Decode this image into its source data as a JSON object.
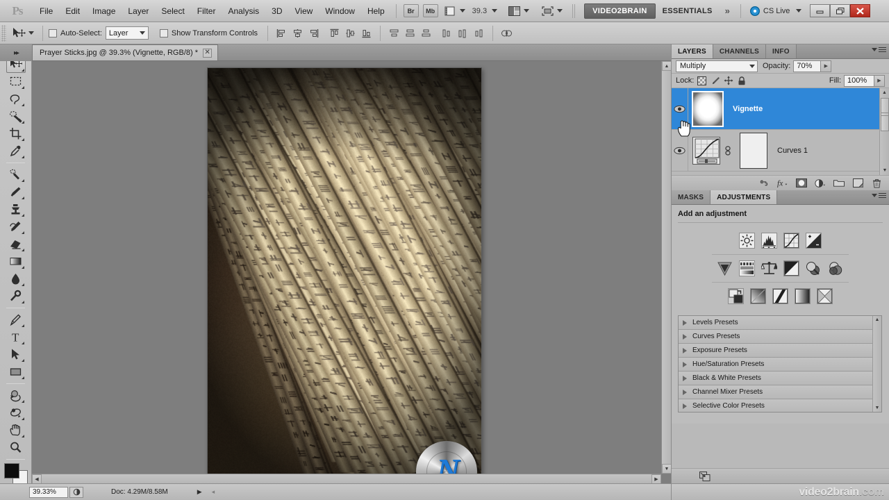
{
  "app": {
    "name": "Adobe Photoshop CS5",
    "logo_text": "Ps"
  },
  "menubar": {
    "items": [
      "File",
      "Edit",
      "Image",
      "Layer",
      "Select",
      "Filter",
      "Analysis",
      "3D",
      "View",
      "Window",
      "Help"
    ],
    "bridge_label": "Br",
    "minibridge_label": "Mb",
    "zoom_value": "39.3",
    "workspace_active": "VIDEO2BRAIN",
    "workspace_secondary": "ESSENTIALS",
    "overflow_label": "»",
    "cs_live_label": "CS Live",
    "window_buttons": {
      "minimize": "–",
      "restore": "❐",
      "close": "✕"
    }
  },
  "optionsbar": {
    "tool_icon": "move-tool-icon",
    "auto_select_label": "Auto-Select:",
    "auto_select_checked": false,
    "auto_select_value": "Layer",
    "show_transform_label": "Show Transform Controls",
    "show_transform_checked": false,
    "align_icons": [
      "align-left-edges-icon",
      "align-horizontal-centers-icon",
      "align-right-edges-icon",
      "align-top-edges-icon",
      "align-vertical-centers-icon",
      "align-bottom-edges-icon"
    ],
    "distribute_icons": [
      "distribute-top-edges-icon",
      "distribute-vertical-centers-icon",
      "distribute-bottom-edges-icon",
      "distribute-left-edges-icon",
      "distribute-horizontal-centers-icon",
      "distribute-right-edges-icon"
    ],
    "threed_axis_icon": "3d-axis-icon"
  },
  "toolbar": {
    "tools": [
      {
        "name": "move-tool",
        "selected": true,
        "has_submenu": true
      },
      {
        "name": "rectangular-marquee-tool",
        "selected": false,
        "has_submenu": true
      },
      {
        "name": "lasso-tool",
        "selected": false,
        "has_submenu": true
      },
      {
        "name": "quick-selection-tool",
        "selected": false,
        "has_submenu": true
      },
      {
        "name": "crop-tool",
        "selected": false,
        "has_submenu": true
      },
      {
        "name": "eyedropper-tool",
        "selected": false,
        "has_submenu": true
      },
      {
        "name": "spot-healing-brush-tool",
        "selected": false,
        "has_submenu": true
      },
      {
        "name": "brush-tool",
        "selected": false,
        "has_submenu": true
      },
      {
        "name": "clone-stamp-tool",
        "selected": false,
        "has_submenu": true
      },
      {
        "name": "history-brush-tool",
        "selected": false,
        "has_submenu": true
      },
      {
        "name": "eraser-tool",
        "selected": false,
        "has_submenu": true
      },
      {
        "name": "gradient-tool",
        "selected": false,
        "has_submenu": true
      },
      {
        "name": "blur-tool",
        "selected": false,
        "has_submenu": true
      },
      {
        "name": "dodge-tool",
        "selected": false,
        "has_submenu": true
      },
      {
        "name": "pen-tool",
        "selected": false,
        "has_submenu": true
      },
      {
        "name": "horizontal-type-tool",
        "selected": false,
        "has_submenu": true
      },
      {
        "name": "path-selection-tool",
        "selected": false,
        "has_submenu": true
      },
      {
        "name": "rectangle-shape-tool",
        "selected": false,
        "has_submenu": true
      },
      {
        "name": "3d-object-rotate-tool",
        "selected": false,
        "has_submenu": true
      },
      {
        "name": "3d-camera-orbit-tool",
        "selected": false,
        "has_submenu": true
      },
      {
        "name": "hand-tool",
        "selected": false,
        "has_submenu": true
      },
      {
        "name": "zoom-tool",
        "selected": false,
        "has_submenu": false
      }
    ],
    "foreground_color": "#0d0d0d",
    "background_color": "#f2f2f2",
    "quick_mask_name": "quick-mask-mode"
  },
  "document": {
    "tab_title": "Prayer Sticks.jpg @ 39.3% (Vignette, RGB/8) *",
    "close_label": "✕",
    "image_subject": "Sepia photograph of Japanese wooden prayer sticks inscribed with kanji"
  },
  "statusbar": {
    "zoom_percent": "39.33%",
    "doc_info": "Doc: 4.29M/8.58M",
    "arrow": "▶"
  },
  "layers_panel": {
    "tabs": [
      {
        "label": "LAYERS",
        "active": true
      },
      {
        "label": "CHANNELS",
        "active": false
      },
      {
        "label": "INFO",
        "active": false
      }
    ],
    "blend_mode": "Multiply",
    "opacity_label": "Opacity:",
    "opacity_value": "70%",
    "lock_label": "Lock:",
    "lock_icons": [
      "lock-transparent-pixels-icon",
      "lock-image-pixels-icon",
      "lock-position-icon",
      "lock-all-icon"
    ],
    "fill_label": "Fill:",
    "fill_value": "100%",
    "layers": [
      {
        "name": "Vignette",
        "visible": true,
        "selected": true,
        "thumb": "white-radial-gradient-mask"
      },
      {
        "name": "Curves 1",
        "visible": true,
        "selected": false,
        "thumb": "curves-adjustment-icon",
        "mask": "white-layer-mask"
      }
    ],
    "bottom_icons": [
      "link-layers-icon",
      "layer-style-fx-icon",
      "add-layer-mask-icon",
      "new-adjustment-layer-icon",
      "new-group-icon",
      "new-layer-icon",
      "delete-layer-icon"
    ],
    "selected_row_color": "#2f87d8"
  },
  "adjustments_panel": {
    "tabs": [
      {
        "label": "MASKS",
        "active": false
      },
      {
        "label": "ADJUSTMENTS",
        "active": true
      }
    ],
    "title": "Add an adjustment",
    "row1_icons": [
      "brightness-contrast-icon",
      "levels-icon",
      "curves-icon",
      "exposure-icon"
    ],
    "row2_icons": [
      "vibrance-icon",
      "hue-saturation-icon",
      "color-balance-icon",
      "black-and-white-icon",
      "photo-filter-icon",
      "channel-mixer-icon"
    ],
    "row3_icons": [
      "invert-icon",
      "posterize-icon",
      "threshold-icon",
      "gradient-map-icon",
      "selective-color-icon"
    ],
    "presets": [
      "Levels Presets",
      "Curves Presets",
      "Exposure Presets",
      "Hue/Saturation Presets",
      "Black & White Presets",
      "Channel Mixer Presets",
      "Selective Color Presets"
    ],
    "footer_icon": "expand-panel-icon"
  },
  "watermark": {
    "brand_main": "video2brain",
    "brand_suffix": ".com",
    "logo_letter": "N"
  },
  "cursor": {
    "type": "pointing-hand-cursor"
  }
}
